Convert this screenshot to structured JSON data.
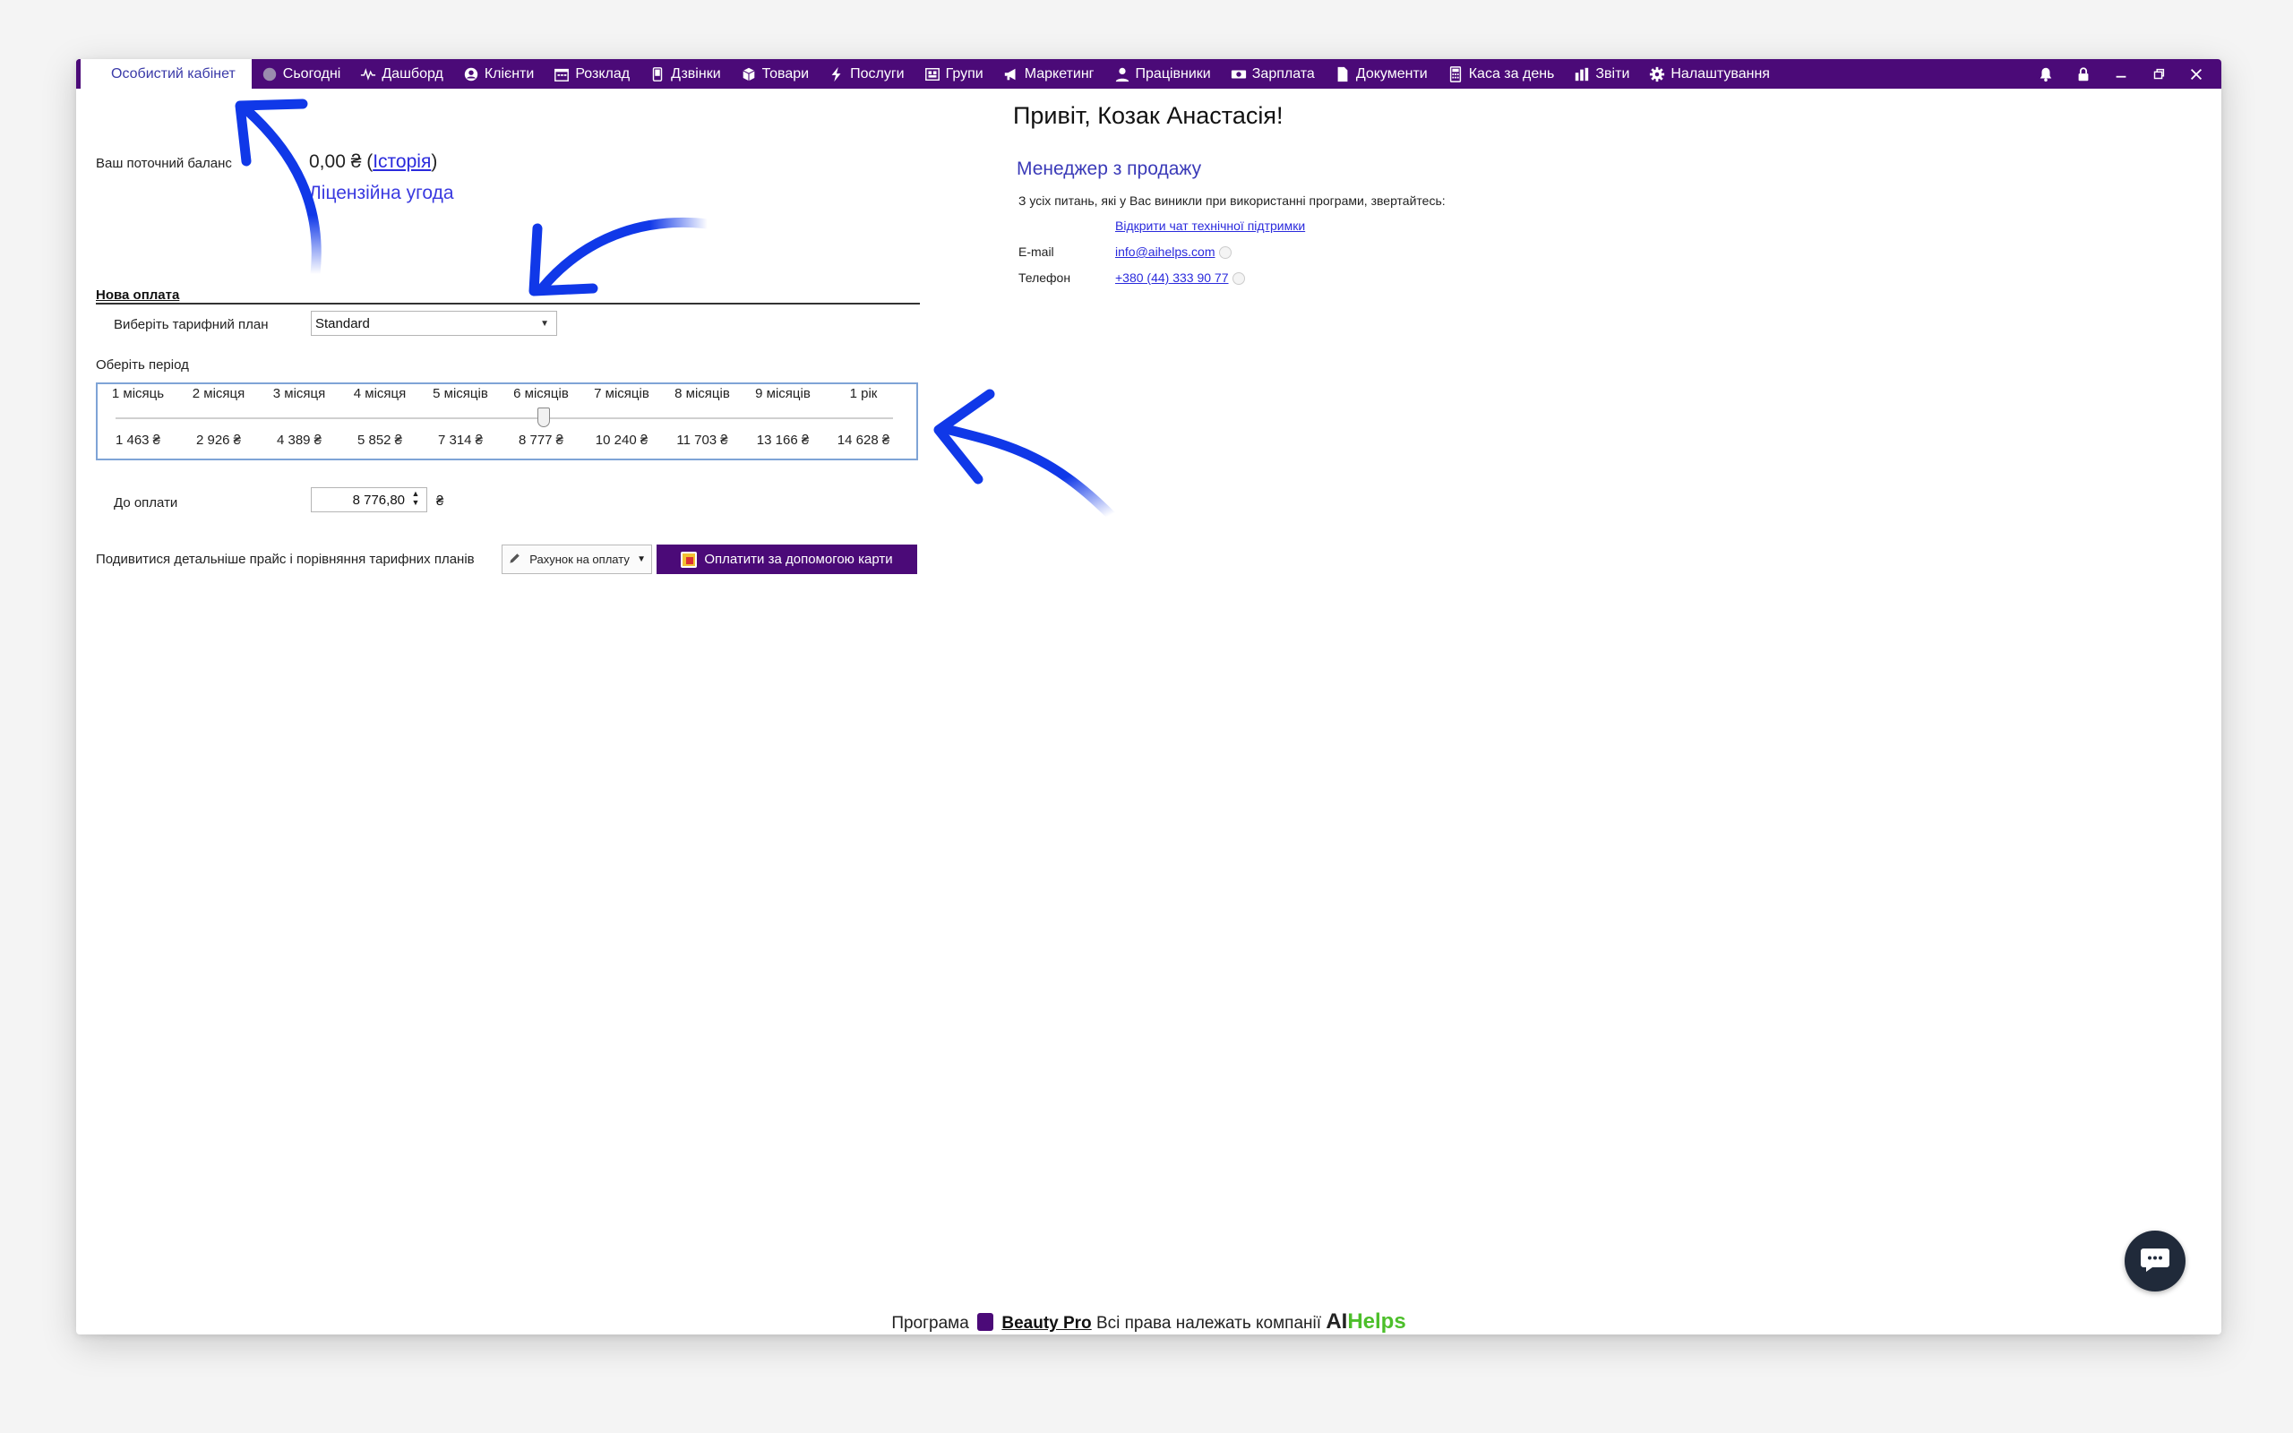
{
  "nav": {
    "tabs": [
      {
        "label": "Особистий кабінет",
        "icon": "none",
        "active": true
      },
      {
        "label": "Сьогодні",
        "icon": "clock-icon"
      },
      {
        "label": "Дашборд",
        "icon": "pulse-icon"
      },
      {
        "label": "Клієнти",
        "icon": "user-circle-icon"
      },
      {
        "label": "Розклад",
        "icon": "calendar-icon"
      },
      {
        "label": "Дзвінки",
        "icon": "phone-icon"
      },
      {
        "label": "Товари",
        "icon": "box-icon"
      },
      {
        "label": "Послуги",
        "icon": "bolt-icon"
      },
      {
        "label": "Групи",
        "icon": "group-icon"
      },
      {
        "label": "Маркетинг",
        "icon": "megaphone-icon"
      },
      {
        "label": "Працівники",
        "icon": "person-icon"
      },
      {
        "label": "Зарплата",
        "icon": "money-icon"
      },
      {
        "label": "Документи",
        "icon": "document-icon"
      },
      {
        "label": "Каса за день",
        "icon": "calculator-icon"
      },
      {
        "label": "Звіти",
        "icon": "bar-chart-icon"
      },
      {
        "label": "Налаштування",
        "icon": "gear-icon"
      }
    ],
    "accent_color": "#4b0a78"
  },
  "balance": {
    "label": "Ваш поточний баланс",
    "value": "0,00 ₴",
    "history_link": "Історія",
    "license_link": "Ліцензійна угода"
  },
  "new_payment": {
    "title": "Нова оплата",
    "plan_label": "Виберіть тарифний план",
    "plan_value": "Standard",
    "period_label": "Оберіть період",
    "periods": [
      {
        "name": "1 місяць",
        "price": "1 463 ₴"
      },
      {
        "name": "2 місяця",
        "price": "2 926 ₴"
      },
      {
        "name": "3 місяця",
        "price": "4 389 ₴"
      },
      {
        "name": "4 місяця",
        "price": "5 852 ₴"
      },
      {
        "name": "5 місяців",
        "price": "7 314 ₴"
      },
      {
        "name": "6 місяців",
        "price": "8 777 ₴"
      },
      {
        "name": "7 місяців",
        "price": "10 240 ₴"
      },
      {
        "name": "8 місяців",
        "price": "11 703 ₴"
      },
      {
        "name": "9 місяців",
        "price": "13 166 ₴"
      },
      {
        "name": "1 рік",
        "price": "14 628 ₴"
      }
    ],
    "selected_period": "6 місяців",
    "pay_label": "До оплати",
    "pay_value": "8 776,80",
    "currency": "₴",
    "compare_label": "Подивитися детальніше прайс і порівняння тарифних планів",
    "invoice_button": "Рахунок на оплату",
    "card_button": "Оплатити за допомогою карти"
  },
  "contact": {
    "greeting": "Привіт, Козак Анастасія!",
    "manager_title": "Менеджер з продажу",
    "support_text": "З усіх питань, які у Вас виникли при використанні програми, звертайтесь:",
    "support_link": "Відкрити чат технічної підтримки",
    "email_label": "E-mail",
    "email": "info@aihelps.com",
    "phone_label": "Телефон",
    "phone": "+380 (44) 333 90 77"
  },
  "footer": {
    "prefix": "Програма",
    "product": "Beauty Pro",
    "rights": "Всі права належать компанії",
    "company_ai": "AI",
    "company_helps": "Helps"
  },
  "annotation_color": "#1038e8"
}
